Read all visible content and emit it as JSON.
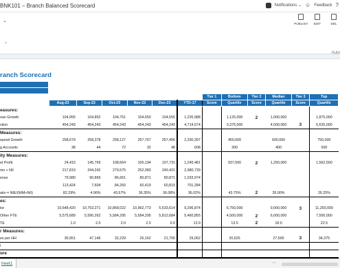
{
  "window": {
    "title": "BNK101 – Branch Balanced Scorecard"
  },
  "topbar": {
    "notifications_label": "Notifications ⌄",
    "feedback_label": "Feedback"
  },
  "ribbon": {
    "chevron": "⌄",
    "chevron2": "⌄",
    "buttons": [
      {
        "label": "PUBLISH",
        "icon": "publish-icon"
      },
      {
        "label": "EDIT",
        "icon": "edit-icon"
      },
      {
        "label": "DEL",
        "icon": "delete-icon"
      }
    ],
    "auto_text": "Auto"
  },
  "sheet": {
    "title": "ranch Scorecard",
    "headers": {
      "months": [
        "Aug-23",
        "Sep-23",
        "Oct-23",
        "Nov-23",
        "Dec-23"
      ],
      "ytd": "YTD-17",
      "tiers_top": [
        "Tier 1",
        "Bottom",
        "Tier 2",
        "Median",
        "Tier 3",
        "Top"
      ],
      "tiers_bottom": [
        "Score",
        "Quartile",
        "Score",
        "Quartile",
        "Score",
        "Quartile"
      ]
    },
    "rows": [
      {
        "type": "section",
        "label": "easures:"
      },
      {
        "label": "oan Growth",
        "m": [
          "104,955",
          "104,852",
          "104,751",
          "104,650",
          "104,555"
        ],
        "ytd": "1,235,988",
        "q1": "1,125,000",
        "s2": "2",
        "q2": "1,000,000",
        "s3": "",
        "q3": "1,875,000"
      },
      {
        "label": "ction",
        "m": [
          "454,243",
          "454,243",
          "454,243",
          "454,243",
          "454,243"
        ],
        "ytd": "4,714,574",
        "q1": "3,375,000",
        "s2": "",
        "q2": "4,500,000",
        "s3": "3",
        "q3": "5,625,000",
        "border": "hb"
      },
      {
        "type": "section",
        "label": "Measures:"
      },
      {
        "label": "eposit Growth",
        "m": [
          "258,679",
          "258,378",
          "258,127",
          "257,767",
          "257,456"
        ],
        "ytd": "2,330,397",
        "q1": "450,000",
        "s2": "",
        "q2": "600,000",
        "s3": "",
        "q3": "750,000"
      },
      {
        "label": "g Accounts",
        "m": [
          "38",
          "44",
          "72",
          "32",
          "48"
        ],
        "ytd": "608",
        "q1": "300",
        "s2": "",
        "q2": "400",
        "s3": "",
        "q3": "500",
        "border": "hb"
      },
      {
        "type": "section",
        "label": "ity Measures:"
      },
      {
        "label": "et Profit",
        "m": [
          "24,415",
          "145,769",
          "108,664",
          "105,194",
          "107,731"
        ],
        "ytd": "1,245,481",
        "q1": "937,500",
        "s2": "2",
        "q2": "1,250,000",
        "s3": "",
        "q3": "1,562,500"
      },
      {
        "label": "ms + NII",
        "m": [
          "217,819",
          "244,242",
          "279,575",
          "252,083",
          "249,421"
        ],
        "ytd": "2,980,739",
        "q1": "",
        "s2": "",
        "q2": "",
        "s3": "",
        "q3": ""
      },
      {
        "label": "ense",
        "m": [
          "79,980",
          "90,869",
          "86,661",
          "80,871",
          "80,871"
        ],
        "ytd": "1,033,974",
        "q1": "",
        "s2": "",
        "q2": "",
        "s3": "",
        "q3": ""
      },
      {
        "label": "",
        "m": [
          "113,424",
          "7,604",
          "84,250",
          "60,419",
          "60,819"
        ],
        "ytd": "701,284",
        "q1": "",
        "s2": "",
        "q2": "",
        "s3": "",
        "q3": ""
      },
      {
        "label": "atio = NIE/(NIM+NII)",
        "m": [
          "82.29%",
          "4.96%",
          "43.67%",
          "36.35%",
          "36.08%"
        ],
        "ytd": "36.02%",
        "q1": "43.75%",
        "s2": "2",
        "q2": "35.00%",
        "s3": "",
        "q3": "26.25%",
        "border": "hb"
      },
      {
        "type": "section",
        "label": "es:"
      },
      {
        "label": "tor",
        "m": [
          "10,648,420",
          "10,753,271",
          "10,858,022",
          "10,962,773",
          "5,533,614"
        ],
        "ytd": "9,296,874",
        "q1": "6,750,000",
        "s2": "",
        "q2": "9,000,000",
        "s3": "3",
        "q3": "11,250,000"
      },
      {
        "label": "Other FTE",
        "m": [
          "5,575,689",
          "5,590,262",
          "5,584,295",
          "5,584,295",
          "5,812,684"
        ],
        "ytd": "5,460,855",
        "q1": "4,500,000",
        "s2": "2",
        "q2": "6,000,000",
        "s3": "",
        "q3": "7,500,000"
      },
      {
        "label": "TE",
        "m": [
          "1.0",
          "2.0",
          "2.0",
          "2.0",
          "0.0"
        ],
        "ytd": "13.9",
        "q1": "13.5",
        "s2": "2",
        "q2": "18.0",
        "s3": "",
        "q3": "22.5",
        "border": "hb"
      },
      {
        "type": "section",
        "label": "r Measures:"
      },
      {
        "label": "es per HH",
        "m": [
          "30,951",
          "47,146",
          "32,229",
          "26,162",
          "21,700"
        ],
        "ytd": "29,062",
        "q1": "20,625",
        "s2": "",
        "q2": "27,500",
        "s3": "3",
        "q3": "34,375",
        "border": "hb"
      },
      {
        "type": "blank",
        "label": "l",
        "border": "hb"
      },
      {
        "type": "section",
        "label": "ore",
        "border": "hb2"
      }
    ]
  },
  "tabs": {
    "sheet_tab": "heet1",
    "nav_dots": "⋯"
  }
}
